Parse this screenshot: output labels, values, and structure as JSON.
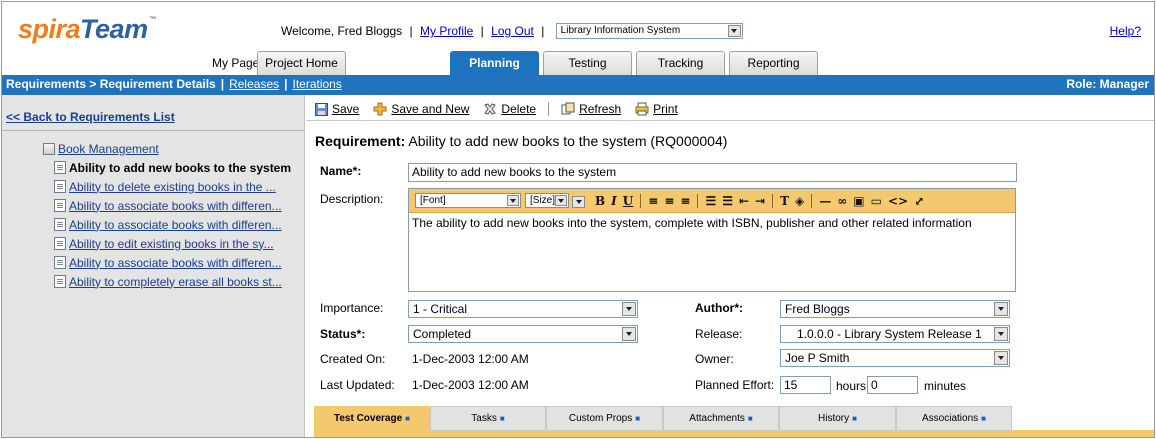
{
  "header": {
    "logo_a": "spira",
    "logo_b": "Team",
    "logo_tm": "™",
    "welcome": "Welcome, Fred Bloggs",
    "my_profile": "My Profile",
    "log_out": "Log Out",
    "project": "Library Information System",
    "help": "Help?",
    "my_page": "My Page",
    "tabs": [
      {
        "label": "Project Home"
      },
      {
        "label": "Planning"
      },
      {
        "label": "Testing"
      },
      {
        "label": "Tracking"
      },
      {
        "label": "Reporting"
      }
    ]
  },
  "navbar": {
    "crumb": "Requirements > Requirement Details",
    "releases": "Releases",
    "iterations": "Iterations",
    "role": "Role: Manager"
  },
  "left": {
    "back": "<< Back to Requirements List",
    "parent": "Book Management",
    "items": [
      {
        "label": "Ability to add new books to the system"
      },
      {
        "label": "Ability to delete existing books in the ..."
      },
      {
        "label": "Ability to associate books with differen..."
      },
      {
        "label": "Ability to associate books with differen..."
      },
      {
        "label": "Ability to edit existing books in the sy..."
      },
      {
        "label": "Ability to associate books with differen..."
      },
      {
        "label": "Ability to completely erase all books st..."
      }
    ]
  },
  "toolbar": {
    "save": "Save",
    "save_new": "Save and New",
    "delete": "Delete",
    "refresh": "Refresh",
    "print": "Print"
  },
  "form": {
    "title_prefix": "Requirement:",
    "title": "Ability to add new books to the system (RQ000004)",
    "name_label": "Name*:",
    "name_value": "Ability to add new books to the system",
    "desc_label": "Description:",
    "font_sel": "[Font]",
    "size_sel": "[Size]",
    "description": "The ability to add new books into the system, complete with ISBN, publisher and other related information",
    "importance_label": "Importance:",
    "importance_value": "1 - Critical",
    "status_label": "Status*:",
    "status_value": "Completed",
    "created_label": "Created On:",
    "created_value": "1-Dec-2003 12:00 AM",
    "updated_label": "Last Updated:",
    "updated_value": "1-Dec-2003 12:00 AM",
    "author_label": "Author*:",
    "author_value": "Fred Bloggs",
    "release_label": "Release:",
    "release_value": "1.0.0.0 - Library System Release 1",
    "owner_label": "Owner:",
    "owner_value": "Joe P Smith",
    "effort_label": "Planned Effort:",
    "effort_hours": "15",
    "hours_label": "hours",
    "effort_minutes": "0",
    "minutes_label": "minutes"
  },
  "bottom_tabs": [
    {
      "label": "Test Coverage"
    },
    {
      "label": "Tasks"
    },
    {
      "label": "Custom Props"
    },
    {
      "label": "Attachments"
    },
    {
      "label": "History"
    },
    {
      "label": "Associations"
    }
  ],
  "colors": {
    "nav_blue": "#1f73bf",
    "editor_orange": "#f4c86c",
    "logo_orange": "#f07c1c",
    "logo_blue": "#2e5f9e"
  }
}
